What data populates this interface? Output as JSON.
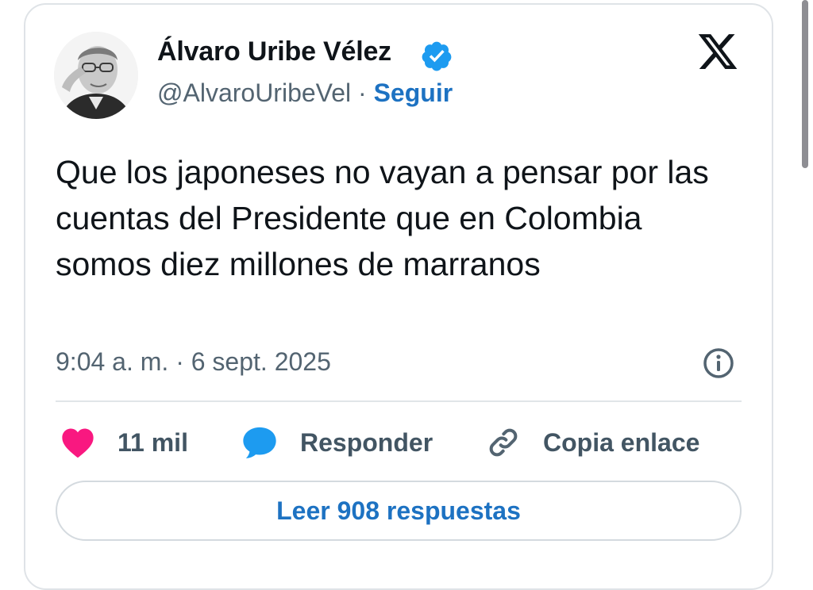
{
  "author": {
    "name": "Álvaro Uribe Vélez",
    "handle": "@AlvaroUribeVel",
    "separator": "·",
    "follow_label": "Seguir"
  },
  "tweet": {
    "text": "Que los japoneses no vayan a pensar por las cuentas del Presidente que en Colombia somos diez millones de marranos",
    "timestamp": "9:04 a. m. · 6 sept. 2025"
  },
  "actions": {
    "like_count": "11 mil",
    "reply_label": "Responder",
    "copy_label": "Copia enlace"
  },
  "read_replies_label": "Leer 908 respuestas",
  "icons": {
    "platform": "x-logo-icon",
    "verified": "verified-badge-icon",
    "info": "info-icon",
    "like": "heart-icon",
    "reply": "speech-bubble-icon",
    "copy": "link-icon"
  },
  "colors": {
    "accent": "#1d72c2",
    "verified": "#1d9bf0",
    "like": "#f91880",
    "text": "#0f1419",
    "muted": "#536471",
    "border": "#dfe3e7"
  }
}
